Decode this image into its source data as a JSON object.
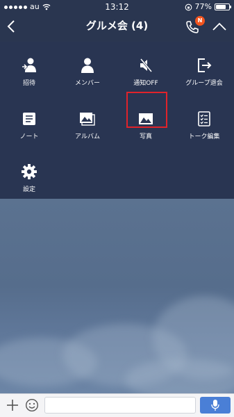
{
  "status_bar": {
    "carrier": "au",
    "time": "13:12",
    "battery": "77%",
    "battery_level": 0.77
  },
  "header": {
    "title": "グルメ会 (4)",
    "badge": "N",
    "icons": {
      "back": "chevron-left-icon",
      "call": "phone-icon",
      "collapse": "chevron-up-icon"
    }
  },
  "menu": {
    "items": [
      {
        "label": "招待",
        "icon": "invite-user-icon"
      },
      {
        "label": "メンバー",
        "icon": "member-icon"
      },
      {
        "label": "通知OFF",
        "icon": "speaker-mute-icon"
      },
      {
        "label": "グループ退会",
        "icon": "exit-group-icon"
      },
      {
        "label": "ノート",
        "icon": "note-icon"
      },
      {
        "label": "アルバム",
        "icon": "album-icon"
      },
      {
        "label": "写真",
        "icon": "photo-icon"
      },
      {
        "label": "トーク編集",
        "icon": "edit-talk-icon"
      },
      {
        "label": "設定",
        "icon": "gear-icon"
      }
    ]
  },
  "input_bar": {
    "placeholder": "",
    "icons": {
      "plus": "plus-icon",
      "emoji": "emoji-icon",
      "mic": "microphone-icon"
    },
    "mic_color": "#4a7fd6"
  },
  "colors": {
    "panel_bg": "#293552",
    "highlight": "#e0232a",
    "badge": "#f2541e"
  }
}
